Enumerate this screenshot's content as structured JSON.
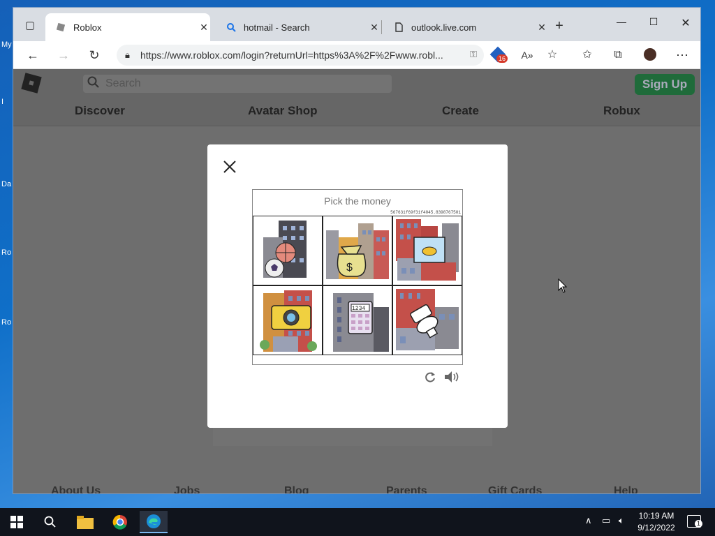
{
  "desktop": {
    "icons": [
      "My",
      "I",
      "Da",
      "Ro",
      "Ro"
    ]
  },
  "browser": {
    "tabs": [
      {
        "label": "Roblox",
        "icon": "roblox-favicon",
        "active": true
      },
      {
        "label": "hotmail - Search",
        "icon": "search-icon",
        "active": false
      },
      {
        "label": "outlook.live.com",
        "icon": "page-icon",
        "active": false
      }
    ],
    "new_tab": "+",
    "url": "https://www.roblox.com/login?returnUrl=https%3A%2F%2Fwww.robl...",
    "badge_count": "16"
  },
  "roblox": {
    "search_placeholder": "Search",
    "signup_label": "Sign Up",
    "nav": [
      "Discover",
      "Avatar Shop",
      "Create",
      "Robux"
    ],
    "footer": [
      "About Us",
      "Jobs",
      "Blog",
      "Parents",
      "Gift Cards",
      "Help"
    ]
  },
  "captcha": {
    "instruction": "Pick the money",
    "challenge_id": "567631f69f31f4045.8398767501",
    "tiles": [
      "basketball-building-tile",
      "money-bag-building-tile",
      "fishbowl-building-tile",
      "camera-building-tile",
      "calculator-building-tile",
      "toilet-building-tile"
    ]
  },
  "taskbar": {
    "time": "10:19 AM",
    "date": "9/12/2022",
    "notification_count": "1"
  },
  "colors": {
    "accent_edge": "#0078d4",
    "signup_green": "#00b06f",
    "captcha_border": "#888888"
  }
}
